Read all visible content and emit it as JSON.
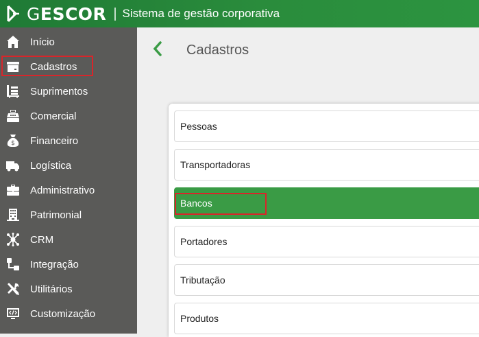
{
  "header": {
    "brand_g": "G",
    "brand_rest": "ESCOR",
    "separator": "|",
    "subtitle": "Sistema de gestão corporativa",
    "color": "#2a8c3c"
  },
  "sidebar": {
    "items": [
      {
        "label": "Início",
        "icon": "home-icon"
      },
      {
        "label": "Cadastros",
        "icon": "register-box-icon"
      },
      {
        "label": "Suprimentos",
        "icon": "cart-list-icon"
      },
      {
        "label": "Comercial",
        "icon": "cash-register-icon"
      },
      {
        "label": "Financeiro",
        "icon": "money-bag-icon"
      },
      {
        "label": "Logística",
        "icon": "truck-icon"
      },
      {
        "label": "Administrativo",
        "icon": "briefcase-icon"
      },
      {
        "label": "Patrimonial",
        "icon": "building-icon"
      },
      {
        "label": "CRM",
        "icon": "network-icon"
      },
      {
        "label": "Integração",
        "icon": "integration-icon"
      },
      {
        "label": "Utilitários",
        "icon": "tools-icon"
      },
      {
        "label": "Customização",
        "icon": "code-screen-icon"
      }
    ]
  },
  "main": {
    "title": "Cadastros",
    "rows": [
      {
        "label": "Pessoas"
      },
      {
        "label": "Transportadoras"
      },
      {
        "label": "Bancos",
        "active": true
      },
      {
        "label": "Portadores"
      },
      {
        "label": "Tributação"
      },
      {
        "label": "Produtos"
      }
    ],
    "active_color": "#3a9b45",
    "highlight_color": "#d9252a"
  }
}
